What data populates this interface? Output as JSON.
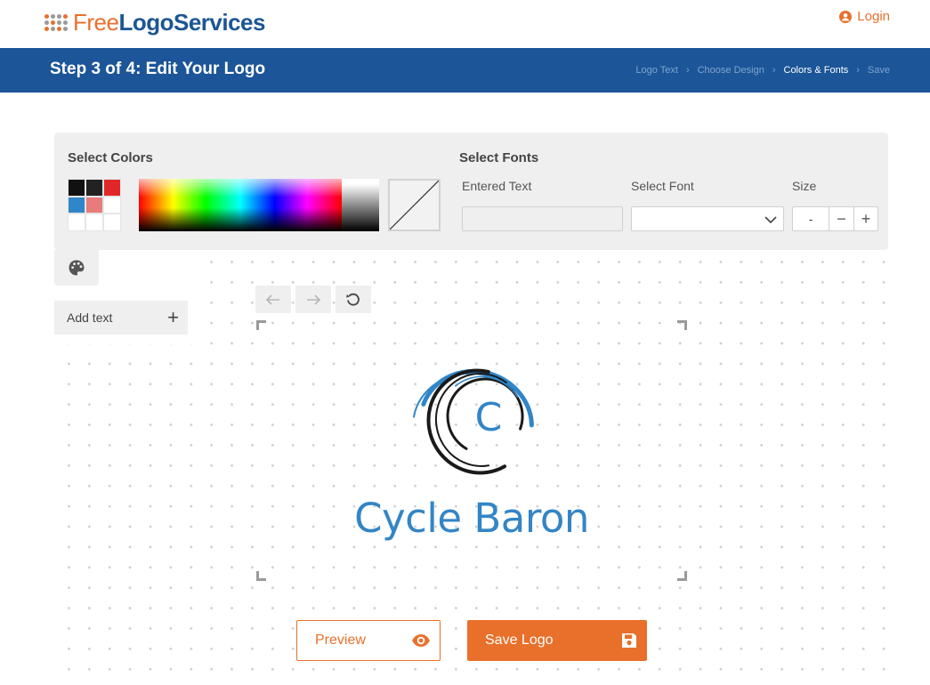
{
  "header": {
    "brand_free": "Free",
    "brand_main": "LogoServices",
    "login_label": "Login",
    "accent_color": "#e8712d",
    "brand_color": "#1c5694"
  },
  "stepbar": {
    "title": "Step 3 of 4: Edit Your Logo",
    "crumbs": [
      {
        "label": "Logo Text",
        "active": false
      },
      {
        "label": "Choose Design",
        "active": false
      },
      {
        "label": "Colors & Fonts",
        "active": true
      },
      {
        "label": "Save",
        "active": false
      }
    ],
    "background": "#1c5598"
  },
  "colors_panel": {
    "title": "Select Colors",
    "swatches": [
      "#111111",
      "#222222",
      "#e02828",
      "#2f86c8",
      "#e87c7c",
      "#ffffff",
      "#ffffff",
      "#ffffff",
      "#ffffff"
    ]
  },
  "fonts_panel": {
    "title": "Select Fonts",
    "entered_text_label": "Entered Text",
    "entered_text_value": "",
    "select_font_label": "Select Font",
    "select_font_value": "",
    "size_label": "Size",
    "size_value": "-",
    "decrease_symbol": "−",
    "increase_symbol": "+"
  },
  "sidebar": {
    "add_text_label": "Add text",
    "add_symbol": "+"
  },
  "canvas": {
    "logo_initial": "C",
    "logo_name": "Cycle Baron",
    "logo_color": "#3385c6"
  },
  "actions": {
    "preview_label": "Preview",
    "save_label": "Save Logo"
  }
}
